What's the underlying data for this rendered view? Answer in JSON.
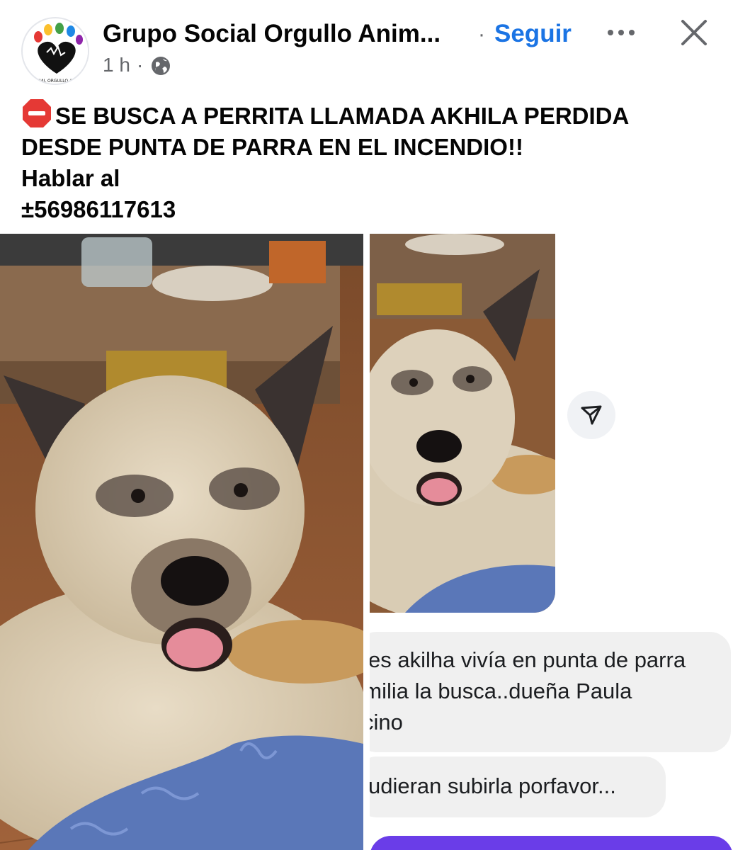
{
  "header": {
    "page_name": "Grupo Social Orgullo Anim...",
    "separator": "·",
    "follow_label": "Seguir",
    "time": "1 h",
    "time_separator": "·",
    "avatar_text": "GRUPO SOCIAL ORGULLO ANIMAL TOMÉ",
    "icons": {
      "more": "more-horizontal-icon",
      "close": "close-icon",
      "audience": "globe-icon"
    }
  },
  "post": {
    "lines": [
      "SE BUSCA A PERRITA LLAMADA AKHILA PERDIDA",
      "DESDE PUNTA DE PARRA EN EL INCENDIO!!",
      "Hablar al",
      "±56986117613"
    ],
    "emoji": "stop-sign-icon"
  },
  "photos": {
    "right": {
      "messages": [
        {
          "lines": [
            "es akilha vivía en punta de parra",
            "amilia la busca..dueña Paula",
            "cino"
          ]
        },
        {
          "lines": [
            "udieran subirla porfavor..."
          ]
        }
      ],
      "share_icon": "send-icon"
    }
  },
  "colors": {
    "accent": "#1b74e4",
    "text": "#050505",
    "meta": "#65676b",
    "bubble": "#f0f0f0",
    "purple": "#6a3de8"
  }
}
